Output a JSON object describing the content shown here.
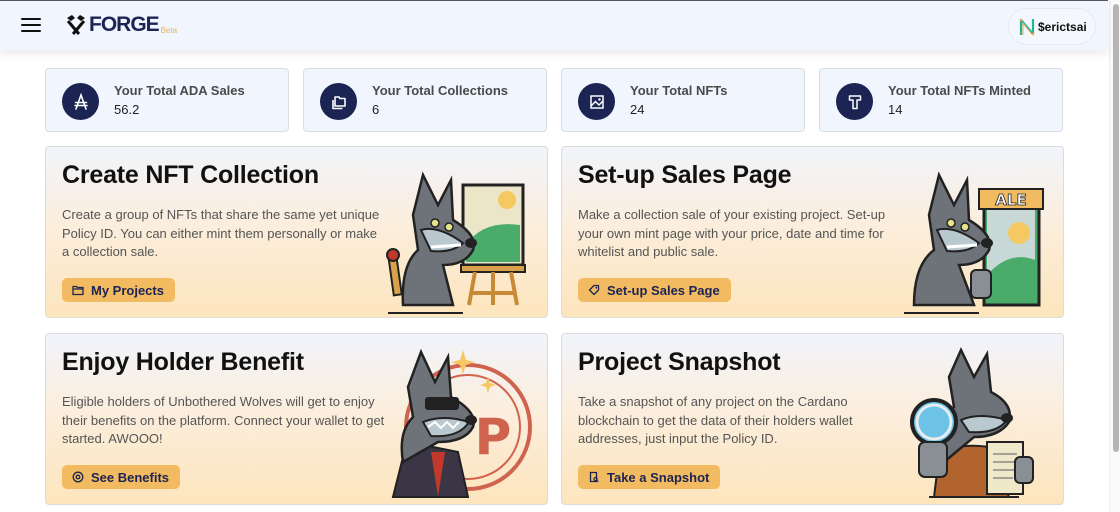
{
  "header": {
    "logo_text": "FORGE",
    "logo_badge": "Beta",
    "username": "$erictsai"
  },
  "stats": [
    {
      "label": "Your Total ADA Sales",
      "value": "56.2",
      "icon": "ada-icon"
    },
    {
      "label": "Your Total Collections",
      "value": "6",
      "icon": "collections-icon"
    },
    {
      "label": "Your Total NFTs",
      "value": "24",
      "icon": "image-icon"
    },
    {
      "label": "Your Total NFTs Minted",
      "value": "14",
      "icon": "hammer-icon"
    }
  ],
  "cards": [
    {
      "title": "Create NFT Collection",
      "description": "Create a group of NFTs that share the same yet unique Policy ID. You can either mint them personally or make a collection sale.",
      "button_label": "My Projects",
      "button_icon": "folder-icon",
      "art": "wolf-painter-illustration"
    },
    {
      "title": "Set-up Sales Page",
      "description": "Make a collection sale of your existing project. Set-up your own mint page with your price, date and time for whitelist and public sale.",
      "button_label": "Set-up Sales Page",
      "button_icon": "tag-icon",
      "art": "wolf-sale-sign-illustration",
      "art_sign_text": "ALE"
    },
    {
      "title": "Enjoy Holder Benefit",
      "description": "Eligible holders of Unbothered Wolves will get to enjoy their benefits on the platform. Connect your wallet to get started. AWOOO!",
      "button_label": "See Benefits",
      "button_icon": "target-icon",
      "art": "wolf-sunglasses-illustration",
      "art_badge_text": "P"
    },
    {
      "title": "Project Snapshot",
      "description": "Take a snapshot of any project on the Cardano blockchain to get the data of their holders wallet addresses, just input the Policy ID.",
      "button_label": "Take a Snapshot",
      "button_icon": "document-search-icon",
      "art": "wolf-magnifier-illustration"
    }
  ],
  "colors": {
    "brand_navy": "#1b2453",
    "button_orange": "#f3bb61",
    "beta_gold": "#e6b35c"
  }
}
